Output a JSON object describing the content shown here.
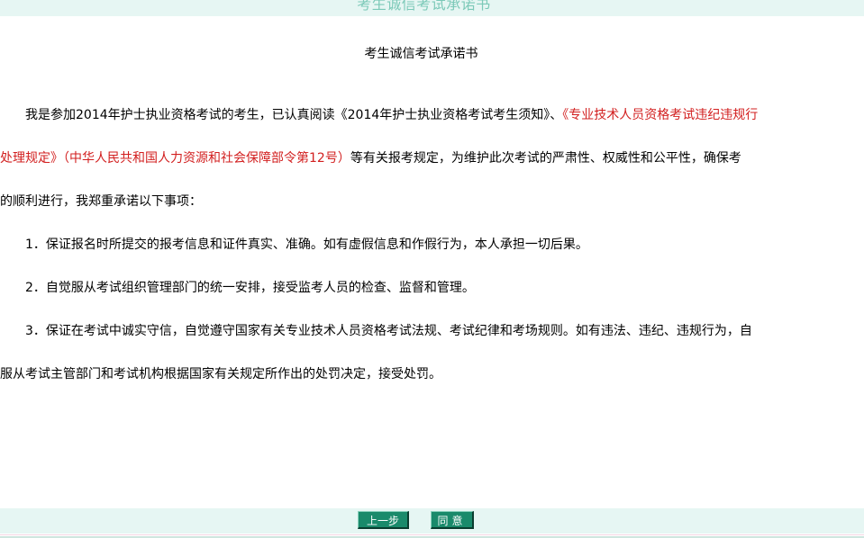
{
  "header": {
    "title": "考生诚信考试承诺书"
  },
  "document": {
    "title": "考生诚信考试承诺书",
    "intro": {
      "line1_a": "　　我是参加2014年护士执业资格考试的考生，已认真阅读《2014年护士执业资格考试考生须知》、",
      "line1_b": "《专业技术人员资格考试违纪违规行",
      "line2_a": "处理规定》（中华人民共和国人力资源和社会保障部令第12号）",
      "line2_b": "等有关报考规定，为维护此次考试的严肃性、权威性和公平性，确保考",
      "line3": "的顺利进行，我郑重承诺以下事项："
    },
    "items": [
      "　　1．保证报名时所提交的报考信息和证件真实、准确。如有虚假信息和作假行为，本人承担一切后果。",
      "　　2．自觉服从考试组织管理部门的统一安排，接受监考人员的检查、监督和管理。",
      "　　3．保证在考试中诚实守信，自觉遵守国家有关专业技术人员资格考试法规、考试纪律和考场规则。如有违法、违纪、违规行为，自",
      "服从考试主管部门和考试机构根据国家有关规定所作出的处罚决定，接受处罚。"
    ]
  },
  "buttons": {
    "prev_label": "上一步",
    "agree_label": "同意"
  },
  "colors": {
    "accent": "#1a8a6b",
    "header_text": "#7cc9b8",
    "header_bg": "#e6f6f3",
    "highlight": "#d21f1f"
  }
}
